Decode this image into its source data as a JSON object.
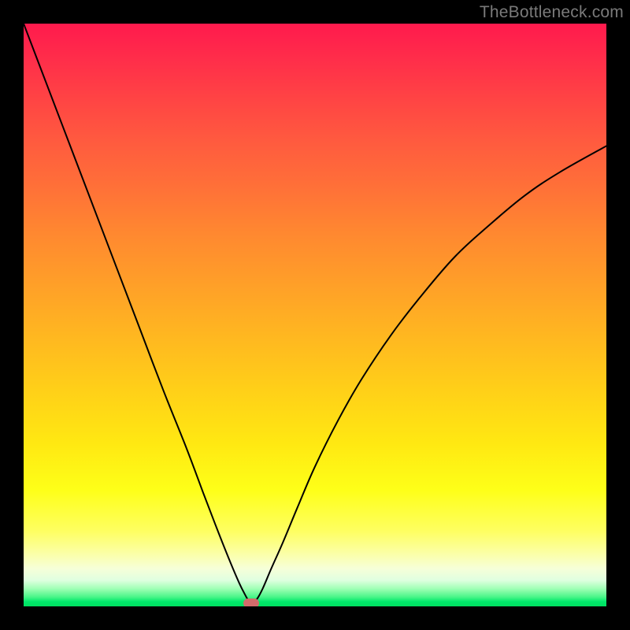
{
  "watermark": "TheBottleneck.com",
  "chart_data": {
    "type": "line",
    "title": "",
    "xlabel": "",
    "ylabel": "",
    "xlim": [
      0,
      100
    ],
    "ylim": [
      0,
      100
    ],
    "marker": {
      "x": 39,
      "y": 0.5,
      "color": "#d26b6b"
    },
    "gradient_stops": [
      {
        "pct": 0,
        "color": "#ff1a4d"
      },
      {
        "pct": 50,
        "color": "#ffb820"
      },
      {
        "pct": 80,
        "color": "#feff18"
      },
      {
        "pct": 95,
        "color": "#e0ffe0"
      },
      {
        "pct": 100,
        "color": "#00e060"
      }
    ],
    "series": [
      {
        "name": "bottleneck-curve",
        "x": [
          0,
          4,
          8,
          12,
          16,
          20,
          24,
          28,
          31,
          33.5,
          35.5,
          37,
          38,
          38.6,
          39.2,
          40,
          41,
          42.5,
          44.5,
          47,
          50,
          54,
          58,
          63,
          68,
          74,
          80,
          86,
          92,
          100
        ],
        "y": [
          100,
          89.5,
          79,
          68.5,
          58,
          47.5,
          37,
          27,
          19,
          12.5,
          7.5,
          4,
          2,
          1,
          0.6,
          1.2,
          3,
          6.5,
          11,
          17,
          24,
          32,
          39,
          46.5,
          53,
          60,
          65.5,
          70.5,
          74.5,
          79
        ]
      }
    ]
  }
}
